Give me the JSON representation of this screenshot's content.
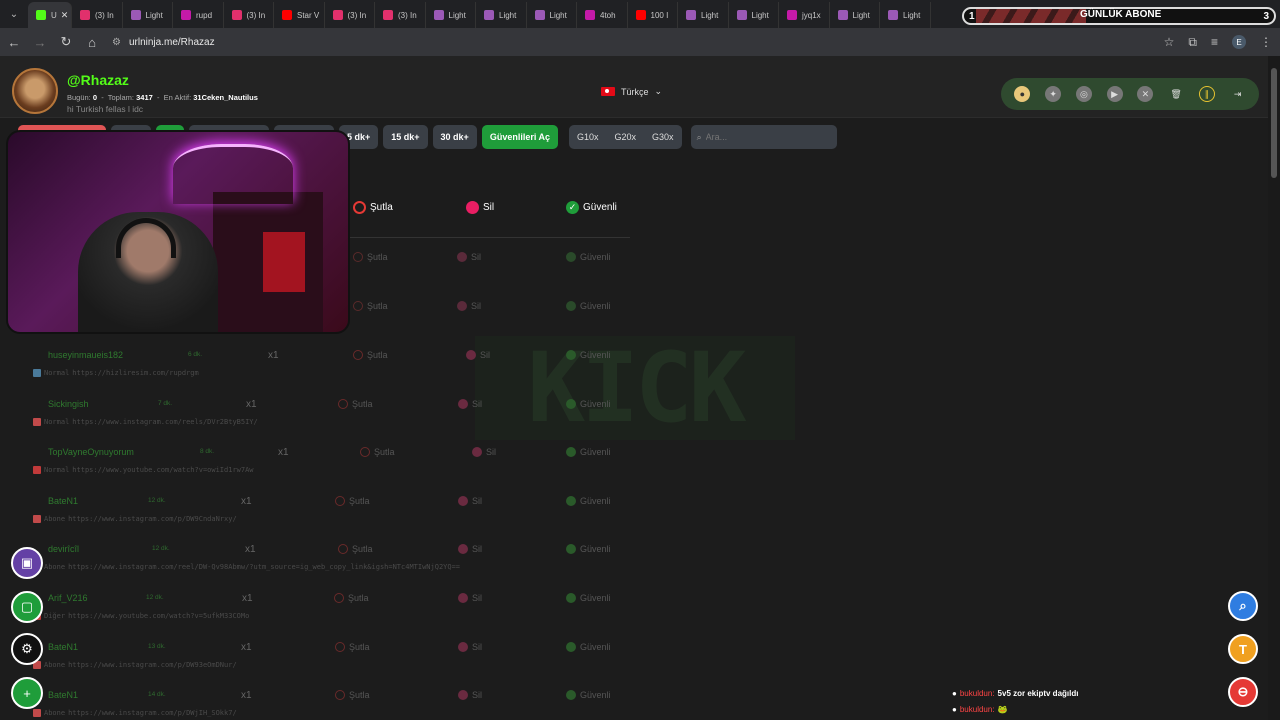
{
  "browser": {
    "tabs": [
      {
        "label": "U",
        "icon": "kick-icon",
        "color": "#53fc18",
        "active": true
      },
      {
        "label": "(3) In",
        "icon": "instagram-icon",
        "color": "#e1306c"
      },
      {
        "label": "Light",
        "icon": "lightshot-icon",
        "color": "#9b59b6"
      },
      {
        "label": "rupd",
        "icon": "hashtag-icon",
        "color": "#c51aa8"
      },
      {
        "label": "(3) In",
        "icon": "instagram-icon",
        "color": "#e1306c"
      },
      {
        "label": "Star V",
        "icon": "youtube-icon",
        "color": "#ff0000"
      },
      {
        "label": "(3) In",
        "icon": "instagram-icon",
        "color": "#e1306c"
      },
      {
        "label": "(3) In",
        "icon": "instagram-icon",
        "color": "#e1306c"
      },
      {
        "label": "Light",
        "icon": "lightshot-icon",
        "color": "#9b59b6"
      },
      {
        "label": "Light",
        "icon": "lightshot-icon",
        "color": "#9b59b6"
      },
      {
        "label": "Light",
        "icon": "lightshot-icon",
        "color": "#9b59b6"
      },
      {
        "label": "4toh",
        "icon": "hashtag-icon",
        "color": "#c51aa8"
      },
      {
        "label": "100 I",
        "icon": "youtube-icon",
        "color": "#ff0000"
      },
      {
        "label": "Light",
        "icon": "lightshot-icon",
        "color": "#9b59b6"
      },
      {
        "label": "Light",
        "icon": "lightshot-icon",
        "color": "#9b59b6"
      },
      {
        "label": "jyq1x",
        "icon": "hashtag-icon",
        "color": "#c51aa8"
      },
      {
        "label": "Light",
        "icon": "lightshot-icon",
        "color": "#9b59b6"
      },
      {
        "label": "Light",
        "icon": "lightshot-icon",
        "color": "#9b59b6"
      }
    ],
    "url": "urlninja.me/Rhazaz",
    "profile_initial": "E"
  },
  "overlay": {
    "sub_goal_title": "GÜNLÜK ABONE",
    "sub_goal_current": "1",
    "sub_goal_target": "3"
  },
  "header": {
    "username": "@Rhazaz",
    "today_label": "Bugün:",
    "today_value": "0",
    "total_label": "Toplam:",
    "total_value": "3417",
    "most_active_label": "En Aktif:",
    "most_active_value": "31Ceken_Nautilus",
    "bio": "hi Turkish fellas l idc",
    "language": "Türkçe"
  },
  "filters": {
    "buttons": [
      "5 dk+",
      "15 dk+",
      "30 dk+"
    ],
    "safe_button": "Güvenlileri Aç",
    "groups": [
      "G10x",
      "G20x",
      "G30x"
    ],
    "search_placeholder": "Ara..."
  },
  "columns": {
    "skip": "Şutla",
    "delete": "Sil",
    "safe": "Güvenli"
  },
  "rows": [
    {
      "user": "huseyinmaueis182",
      "time": "6 dk.",
      "count": "x1",
      "type": "Normal",
      "link": "https://hizliresim.com/rupdrgm",
      "color": "#4a7a9a"
    },
    {
      "user": "Sickingish",
      "time": "7 dk.",
      "count": "x1",
      "type": "Normal",
      "link": "https://www.instagram.com/reels/DVr2BtyB5IY/",
      "color": "#c14a4a"
    },
    {
      "user": "TopVayneOynuyorum",
      "time": "8 dk.",
      "count": "x1",
      "type": "Normal",
      "link": "https://www.youtube.com/watch?v=owiId1rw7Aw",
      "color": "#c13a3a"
    },
    {
      "user": "BateN1",
      "time": "12 dk.",
      "count": "x1",
      "type": "Abone",
      "link": "https://www.instagram.com/p/DW9CndaNrxy/",
      "color": "#c14a4a"
    },
    {
      "user": "devirîcîl",
      "time": "12 dk.",
      "count": "x1",
      "type": "Abone",
      "link": "https://www.instagram.com/reel/DW-Qv98Abmw/?utm_source=ig_web_copy_link&igsh=NTc4MTIwNjQ2YQ==",
      "color": "#c14a4a"
    },
    {
      "user": "Arif_V216",
      "time": "12 dk.",
      "count": "x1",
      "type": "Diğer",
      "link": "https://www.youtube.com/watch?v=5ufkM33COMo",
      "color": "#c13a3a"
    },
    {
      "user": "BateN1",
      "time": "13 dk.",
      "count": "x1",
      "type": "Abone",
      "link": "https://www.instagram.com/p/DW93eOmDNur/",
      "color": "#c14a4a"
    },
    {
      "user": "BateN1",
      "time": "14 dk.",
      "count": "x1",
      "type": "Abone",
      "link": "https://www.instagram.com/p/DWjIH_SOkk7/",
      "color": "#c14a4a"
    }
  ],
  "chat": [
    {
      "user": "bukuldun:",
      "message": "5v5 zor ekiptv dağıldı"
    },
    {
      "user": "bukuldun:",
      "message": "🐸"
    }
  ],
  "colors": {
    "kick_green": "#53fc18",
    "safe_green": "#1f9d3a",
    "skip_red": "#e53935",
    "delete_pink": "#e91e63"
  }
}
